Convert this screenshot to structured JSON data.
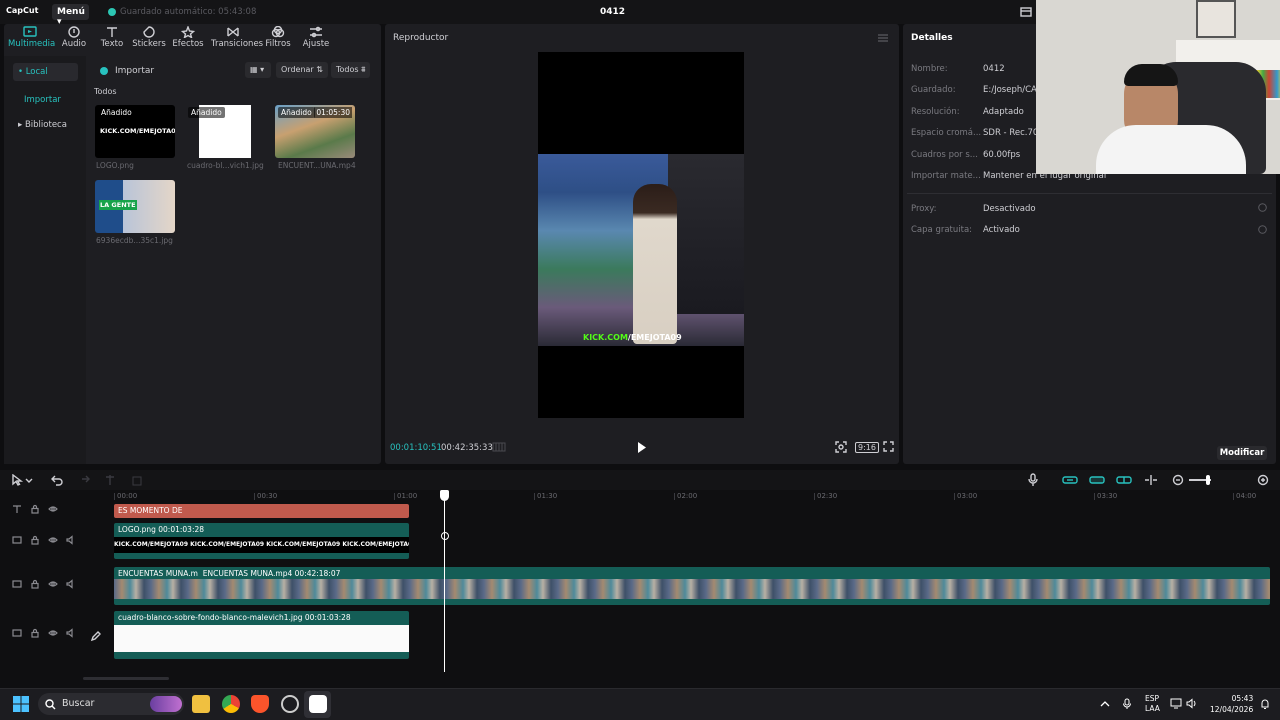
{
  "app": {
    "logo": "CapCut",
    "menu_label": "Menú",
    "autosave": "Guardado automático: 05:43:08",
    "project_title": "0412"
  },
  "toolbar": [
    {
      "label": "Multimedia",
      "icon": "media-icon"
    },
    {
      "label": "Audio",
      "icon": "audio-icon"
    },
    {
      "label": "Texto",
      "icon": "text-icon"
    },
    {
      "label": "Stickers",
      "icon": "sticker-icon"
    },
    {
      "label": "Efectos",
      "icon": "effects-icon"
    },
    {
      "label": "Transiciones",
      "icon": "transitions-icon"
    },
    {
      "label": "Filtros",
      "icon": "filters-icon"
    },
    {
      "label": "Ajuste",
      "icon": "adjust-icon"
    }
  ],
  "sidebar": {
    "local": "• Local",
    "import": "Importar",
    "library": "▸ Biblioteca"
  },
  "media_panel": {
    "import_label": "Importar",
    "sort_label": "Ordenar",
    "filter_label": "Todos",
    "section_label": "Todos",
    "items": [
      {
        "name": "LOGO.png",
        "badge": "Añadido",
        "overlay": "KICK.COM/EMEJOTA09"
      },
      {
        "name": "cuadro-bl...vich1.jpg",
        "badge": "Añadido"
      },
      {
        "name": "ENCUENT...UNA.mp4",
        "badge": "Añadido",
        "duration": "01:05:30"
      },
      {
        "name": "6936ecdb...35c1.jpg",
        "overlay": "LA GENTE"
      }
    ]
  },
  "player": {
    "title": "Reproductor",
    "watermark_prefix": "KICK.COM",
    "watermark_handle": "/EMEJOTA09",
    "current_time": "00:01:10:51",
    "total_time": "00:42:35:33",
    "ratio": "9:16"
  },
  "details": {
    "title": "Detalles",
    "rows": [
      {
        "label": "Nombre:",
        "value": "0412"
      },
      {
        "label": "Guardado:",
        "value": "E:/Joseph/CAP"
      },
      {
        "label": "Resolución:",
        "value": "Adaptado"
      },
      {
        "label": "Espacio cromá...",
        "value": "SDR - Rec.709"
      },
      {
        "label": "Cuadros por s...",
        "value": "60.00fps"
      },
      {
        "label": "Importar mate...",
        "value": "Mantener en el lugar original"
      },
      {
        "label": "Proxy:",
        "value": "Desactivado"
      },
      {
        "label": "Capa gratuita:",
        "value": "Activado"
      }
    ],
    "modify_label": "Modificar"
  },
  "timeline": {
    "ticks": [
      "00:00",
      "00:30",
      "01:00",
      "01:30",
      "02:00",
      "02:30",
      "03:00",
      "03:30",
      "04:00"
    ],
    "tracks": {
      "text_clip": "ES MOMENTO DE",
      "logo_clip": "LOGO.png  00:01:03:28",
      "logo_strip": "KICK.COM/EMEJOTA09",
      "video_clip_a": "ENCUENTAS MUNA.m",
      "video_clip_b": "ENCUENTAS MUNA.mp4  00:42:18:07",
      "white_clip": "cuadro-blanco-sobre-fondo-blanco-malevich1.jpg  00:01:03:28"
    }
  },
  "taskbar": {
    "search": "Buscar",
    "lang1": "ESP",
    "lang2": "LAA",
    "time": "05:43",
    "date": "12/04/2026"
  },
  "colors": {
    "accent": "#28c2bf",
    "clip_teal": "#145d56",
    "text_clip": "#c05a4d",
    "bg": "#0e0e10"
  }
}
